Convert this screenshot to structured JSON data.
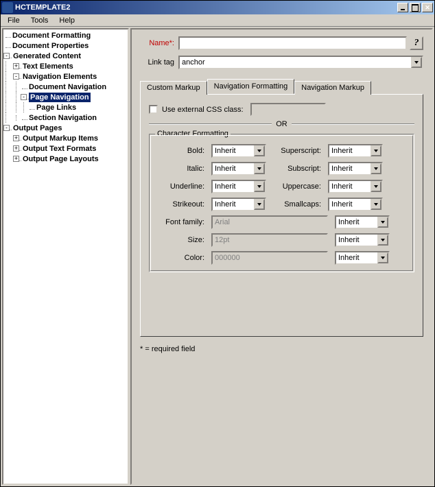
{
  "title": "HCTEMPLATE2",
  "menu": {
    "file": "File",
    "tools": "Tools",
    "help": "Help"
  },
  "tree": {
    "doc_formatting": "Document Formatting",
    "doc_properties": "Document Properties",
    "generated_content": "Generated Content",
    "text_elements": "Text Elements",
    "nav_elements": "Navigation Elements",
    "doc_navigation": "Document Navigation",
    "page_navigation": "Page Navigation",
    "page_links": "Page Links",
    "section_navigation": "Section Navigation",
    "output_pages": "Output Pages",
    "output_markup_items": "Output Markup Items",
    "output_text_formats": "Output Text Formats",
    "output_page_layouts": "Output Page Layouts"
  },
  "form": {
    "name_label": "Name*:",
    "name_value": "",
    "link_tag_label": "Link tag",
    "link_tag_value": "anchor"
  },
  "tabs": {
    "custom_markup": "Custom Markup",
    "nav_formatting": "Navigation Formatting",
    "nav_markup": "Navigation Markup"
  },
  "css": {
    "use_external": "Use external CSS class:",
    "or": "OR"
  },
  "charfmt": {
    "title": "Character Formatting",
    "bold": "Bold:",
    "italic": "Italic:",
    "underline": "Underline:",
    "strikeout": "Strikeout:",
    "superscript": "Superscript:",
    "subscript": "Subscript:",
    "uppercase": "Uppercase:",
    "smallcaps": "Smallcaps:",
    "font_family": "Font family:",
    "size": "Size:",
    "color": "Color:",
    "inherit": "Inherit",
    "font_family_value": "Arial",
    "size_value": "12pt",
    "color_value": "000000"
  },
  "footnote": "* = required field"
}
